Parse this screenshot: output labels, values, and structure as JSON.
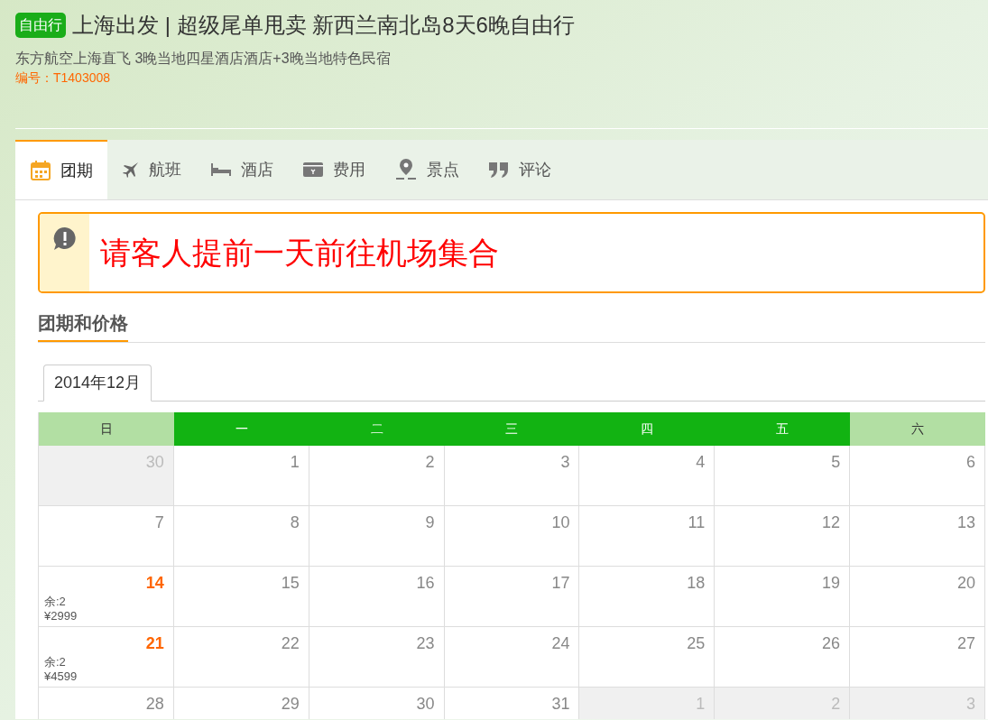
{
  "header": {
    "badge": "自由行",
    "title": "上海出发 | 超级尾单甩卖 新西兰南北岛8天6晚自由行",
    "subtitle": "东方航空上海直飞 3晚当地四星酒店酒店+3晚当地特色民宿",
    "code": "编号：T1403008"
  },
  "tabs": [
    {
      "kind": "calendar",
      "label": "团期",
      "selected": true
    },
    {
      "kind": "plane",
      "label": "航班",
      "selected": false
    },
    {
      "kind": "bed",
      "label": "酒店",
      "selected": false
    },
    {
      "kind": "fee",
      "label": "费用",
      "selected": false
    },
    {
      "kind": "pin",
      "label": "景点",
      "selected": false
    },
    {
      "kind": "quote",
      "label": "评论",
      "selected": false
    }
  ],
  "notice": "请客人提前一天前往机场集合",
  "section_title": "团期和价格",
  "month_tabs": [
    {
      "label": "2014年12月",
      "selected": true
    }
  ],
  "weekdays": [
    {
      "label": "日",
      "weekend": true
    },
    {
      "label": "一",
      "weekend": false
    },
    {
      "label": "二",
      "weekend": false
    },
    {
      "label": "三",
      "weekend": false
    },
    {
      "label": "四",
      "weekend": false
    },
    {
      "label": "五",
      "weekend": false
    },
    {
      "label": "六",
      "weekend": true
    }
  ],
  "weeks": [
    [
      {
        "day": "30",
        "kind": "other"
      },
      {
        "day": "1",
        "kind": "normal"
      },
      {
        "day": "2",
        "kind": "normal"
      },
      {
        "day": "3",
        "kind": "normal"
      },
      {
        "day": "4",
        "kind": "normal"
      },
      {
        "day": "5",
        "kind": "normal"
      },
      {
        "day": "6",
        "kind": "normal"
      }
    ],
    [
      {
        "day": "7",
        "kind": "normal"
      },
      {
        "day": "8",
        "kind": "normal"
      },
      {
        "day": "9",
        "kind": "normal"
      },
      {
        "day": "10",
        "kind": "normal"
      },
      {
        "day": "11",
        "kind": "normal"
      },
      {
        "day": "12",
        "kind": "normal"
      },
      {
        "day": "13",
        "kind": "normal"
      }
    ],
    [
      {
        "day": "14",
        "kind": "available",
        "remaining": "余:2",
        "price": "¥2999"
      },
      {
        "day": "15",
        "kind": "normal"
      },
      {
        "day": "16",
        "kind": "normal"
      },
      {
        "day": "17",
        "kind": "normal"
      },
      {
        "day": "18",
        "kind": "normal"
      },
      {
        "day": "19",
        "kind": "normal"
      },
      {
        "day": "20",
        "kind": "normal"
      }
    ],
    [
      {
        "day": "21",
        "kind": "available",
        "remaining": "余:2",
        "price": "¥4599"
      },
      {
        "day": "22",
        "kind": "normal"
      },
      {
        "day": "23",
        "kind": "normal"
      },
      {
        "day": "24",
        "kind": "normal"
      },
      {
        "day": "25",
        "kind": "normal"
      },
      {
        "day": "26",
        "kind": "normal"
      },
      {
        "day": "27",
        "kind": "normal"
      }
    ],
    [
      {
        "day": "28",
        "kind": "normal"
      },
      {
        "day": "29",
        "kind": "normal"
      },
      {
        "day": "30",
        "kind": "normal"
      },
      {
        "day": "31",
        "kind": "normal"
      },
      {
        "day": "1",
        "kind": "other"
      },
      {
        "day": "2",
        "kind": "other"
      },
      {
        "day": "3",
        "kind": "other"
      }
    ]
  ]
}
